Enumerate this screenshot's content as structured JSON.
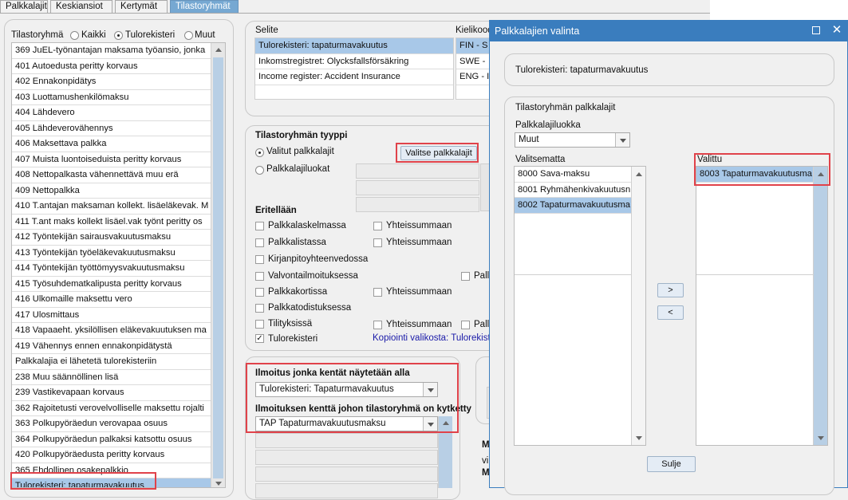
{
  "tabs": [
    "Palkkalajit",
    "Keskiansiot",
    "Kertymät",
    "Tilastoryhmät"
  ],
  "left": {
    "label": "Tilastoryhmä",
    "radios": [
      "Kaikki",
      "Tulorekisteri",
      "Muut"
    ],
    "items": [
      "369 JuEL-työnantajan maksama työansio, jonka",
      "401 Autoedusta peritty korvaus",
      "402 Ennakonpidätys",
      "403 Luottamushenkilömaksu",
      "404 Lähdevero",
      "405 Lähdeverovähennys",
      "406 Maksettava palkka",
      "407 Muista luontoiseduista peritty korvaus",
      "408 Nettopalkasta vähennettävä muu erä",
      "409 Nettopalkka",
      "410 T.antajan maksaman kollekt. lisäeläkevak. M",
      "411 T.ant maks kollekt lisäel.vak työnt peritty os",
      "412 Työntekijän sairausvakuutusmaksu",
      "413 Työntekijän työeläkevakuutusmaksu",
      "414 Työntekijän työttömyysvakuutusmaksu",
      "415 Työsuhdematkalipusta peritty korvaus",
      "416 Ulkomaille maksettu vero",
      "417 Ulosmittaus",
      "418 Vapaaeht. yksilöllisen eläkevakuutuksen ma",
      "419 Vähennys ennen ennakonpidätystä",
      "Palkkalajia ei lähetetä tulorekisteriin",
      "238 Muu säännöllinen lisä",
      "239 Vastikevapaan korvaus",
      "362 Rajoitetusti verovelvolliselle maksettu rojalti",
      "363 Polkupyöräedun verovapaa osuus",
      "364 Polkupyöräedun palkaksi katsottu osuus",
      "420 Polkupyöräedusta peritty korvaus",
      "365 Ehdollinen osakepalkkio",
      "Tulorekisteri: tapaturmavakuutus"
    ]
  },
  "selite": {
    "header": "Selite",
    "lang_header": "Kielikood",
    "rows": [
      {
        "text": "Tulorekisteri: tapaturmavakuutus",
        "lang": "FIN - S"
      },
      {
        "text": "Inkomstregistret: Olycksfallsförsäkring",
        "lang": "SWE -"
      },
      {
        "text": "Income register: Accident Insurance",
        "lang": "ENG - I"
      }
    ]
  },
  "tyyppi": {
    "title": "Tilastoryhmän tyyppi",
    "opt1": "Valitut palkkalajit",
    "opt2": "Palkkalajiluokat",
    "button": "Valitse palkkalajit",
    "eritellaan": "Eritellään",
    "checks": [
      "Palkkalaskelmassa",
      "Palkkalistassa",
      "Kirjanpitoyhteenvedossa",
      "Valvontailmoituksessa",
      "Palkkakortissa",
      "Palkkatodistuksessa",
      "Tilityksissä",
      "Tulorekisteri"
    ],
    "yhteis": "Yhteissummaan",
    "pall": "Pall",
    "kopiointi": "Kopiointi valikosta: Tulorekist"
  },
  "ilmoitus": {
    "label1": "Ilmoitus jonka kentät näytetään alla",
    "value1": "Tulorekisteri: Tapaturmavakuutus",
    "label2": "Ilmoituksen kenttä johon tilastoryhmä on kytketty",
    "value2": "TAP Tapaturmavakuutusmaksu"
  },
  "edge": {
    "m1": "M",
    "vi": "vi",
    "m2": "M"
  },
  "dialog": {
    "title": "Palkkalajien valinta",
    "header_text": "Tulorekisteri: tapaturmavakuutus",
    "group_title": "Tilastoryhmän palkkalajit",
    "class_label": "Palkkalajiluokka",
    "class_value": "Muut",
    "unselected_label": "Valitsematta",
    "unselected": [
      "8000 Sava-maksu",
      "8001 Ryhmähenkivakuutusn",
      "8002 Tapaturmavakuutusma"
    ],
    "selected_label": "Valittu",
    "selected": [
      "8003 Tapaturmavakuutusma"
    ],
    "btn_add": ">",
    "btn_remove": "<",
    "close": "Sulje"
  },
  "colors": {
    "accent": "#3a7dbe",
    "selection": "#a8c8e8",
    "highlight": "#e0424a"
  }
}
